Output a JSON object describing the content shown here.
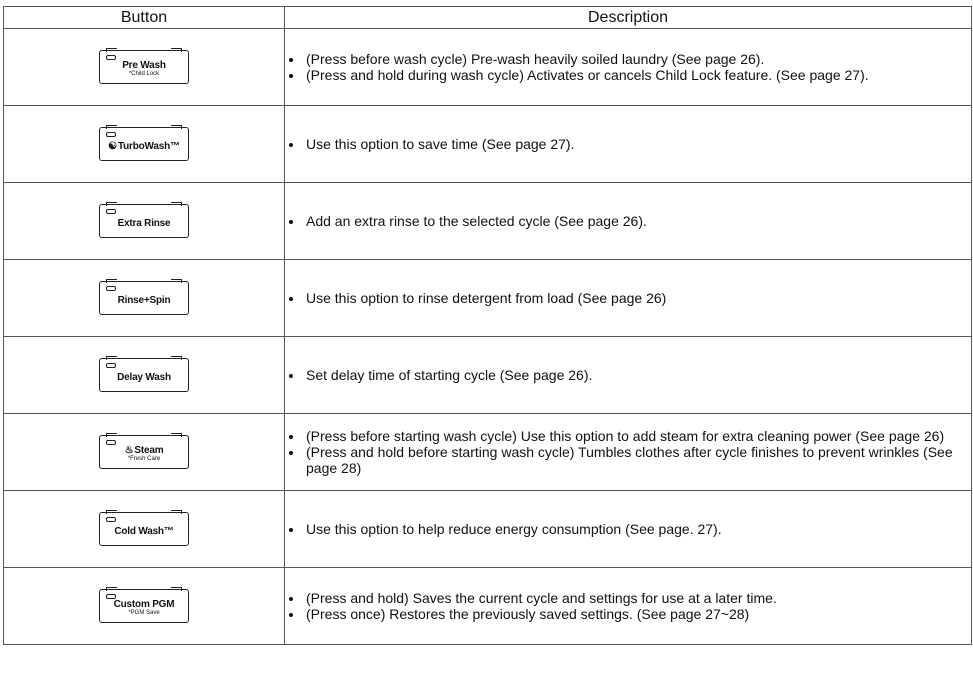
{
  "headers": {
    "button": "Button",
    "description": "Description"
  },
  "rows": [
    {
      "label": "Pre Wash",
      "sub": "*Child Lock",
      "icon": "",
      "bullets": [
        "(Press before wash cycle) Pre-wash heavily soiled laundry (See page 26).",
        "(Press and hold during wash cycle) Activates or cancels Child Lock feature. (See page 27)."
      ]
    },
    {
      "label": "TurboWash™",
      "sub": "",
      "icon": "turbowash-icon",
      "bullets": [
        "Use this option to save time (See page 27)."
      ]
    },
    {
      "label": "Extra Rinse",
      "sub": "",
      "icon": "",
      "bullets": [
        "Add an extra rinse to the selected cycle (See page 26)."
      ]
    },
    {
      "label": "Rinse+Spin",
      "sub": "",
      "icon": "",
      "bullets": [
        "Use this option to rinse detergent from load (See page 26)"
      ]
    },
    {
      "label": "Delay Wash",
      "sub": "",
      "icon": "",
      "bullets": [
        "Set delay time of starting cycle (See page 26)."
      ]
    },
    {
      "label": "Steam",
      "sub": "*Fresh Care",
      "icon": "steam-icon",
      "bullets": [
        "(Press before starting wash cycle) Use this option to add steam for extra cleaning power (See page 26)",
        "(Press and hold before starting wash cycle) Tumbles clothes after cycle finishes to prevent wrinkles (See page 28)"
      ]
    },
    {
      "label": "Cold Wash™",
      "sub": "",
      "icon": "",
      "bullets": [
        "Use this option to help reduce energy consumption (See page. 27)."
      ]
    },
    {
      "label": "Custom PGM",
      "sub": "*PGM Save",
      "icon": "",
      "bullets": [
        "(Press and hold) Saves the current cycle and settings for use at a later time.",
        "(Press once) Restores the previously saved settings. (See page 27~28)"
      ]
    }
  ]
}
